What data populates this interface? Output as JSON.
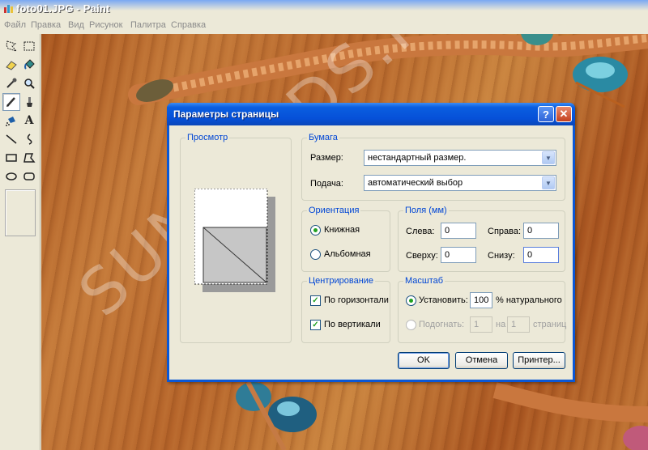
{
  "app": {
    "title": "foto01.JPG - Paint"
  },
  "menu": [
    "Файл",
    "Правка",
    "Вид",
    "Рисунок",
    "Палитра",
    "Справка"
  ],
  "toolbox": {
    "tools": [
      "free-select",
      "rect-select",
      "eraser",
      "fill-bucket",
      "color-picker",
      "magnifier",
      "pencil",
      "brush",
      "airbrush",
      "text",
      "line",
      "curve",
      "rectangle",
      "polygon",
      "ellipse",
      "rounded-rectangle"
    ],
    "selected": "pencil"
  },
  "canvas": {
    "watermark": "SUNBEADS.RU"
  },
  "dialog": {
    "title": "Параметры страницы",
    "help_glyph": "?",
    "close_glyph": "✕",
    "preview": {
      "label": "Просмотр"
    },
    "paper": {
      "label": "Бумага",
      "size_label": "Размер:",
      "size_value": "нестандартный размер.",
      "source_label": "Подача:",
      "source_value": "автоматический выбор"
    },
    "orientation": {
      "label": "Ориентация",
      "portrait": "Книжная",
      "landscape": "Альбомная",
      "selected": "portrait"
    },
    "margins": {
      "label": "Поля (мм)",
      "left_label": "Слева:",
      "left": "0",
      "right_label": "Справа:",
      "right": "0",
      "top_label": "Сверху:",
      "top": "0",
      "bottom_label": "Снизу:",
      "bottom": "0"
    },
    "centering": {
      "label": "Центрирование",
      "horizontal": "По горизонтали",
      "vertical": "По вертикали",
      "horizontal_checked": true,
      "vertical_checked": true
    },
    "scale": {
      "label": "Масштаб",
      "adjust_label": "Установить:",
      "adjust_value": "100",
      "adjust_suffix": "% натурального",
      "fit_label": "Подогнать:",
      "fit_wide": "1",
      "fit_by": "на",
      "fit_tall": "1",
      "fit_suffix": "страниц",
      "selected": "adjust"
    },
    "buttons": {
      "ok": "OK",
      "cancel": "Отмена",
      "printer": "Принтер..."
    }
  }
}
